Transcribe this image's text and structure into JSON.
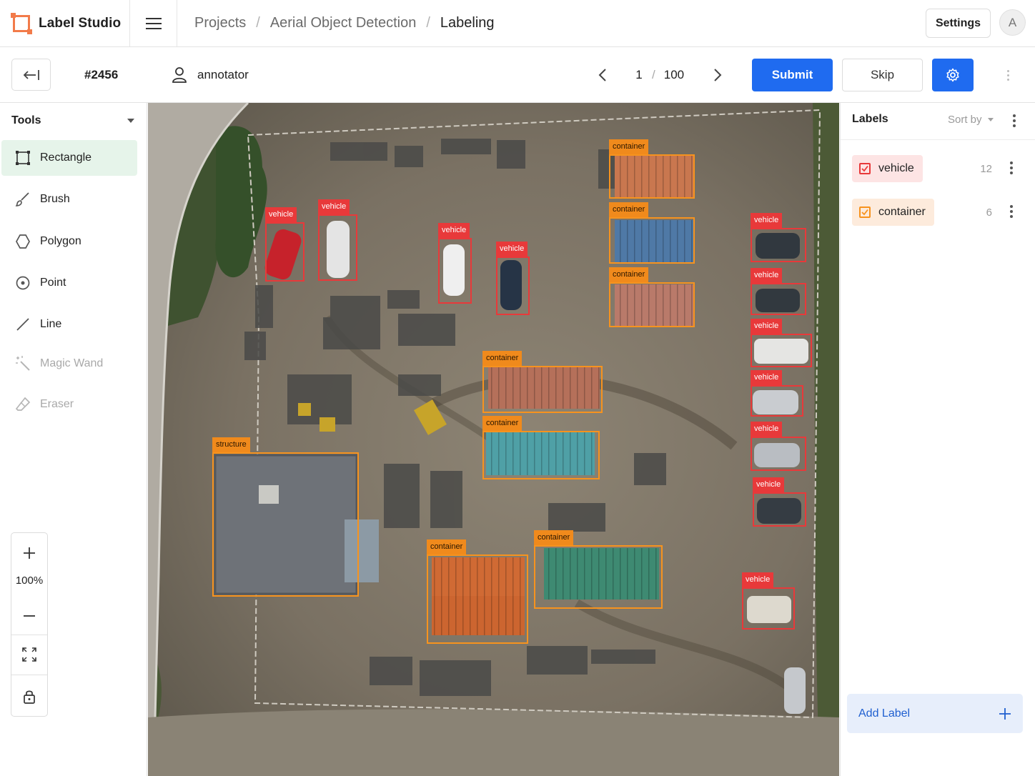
{
  "app": {
    "name": "Label Studio"
  },
  "header": {
    "breadcrumb": [
      "Projects",
      "Aerial Object Detection",
      "Labeling"
    ],
    "settings_label": "Settings",
    "avatar_initial": "A"
  },
  "task": {
    "id": "#2456",
    "annotator": "annotator",
    "page_current": "1",
    "page_separator": "/",
    "page_total": "100",
    "submit_label": "Submit",
    "skip_label": "Skip"
  },
  "tools": {
    "title": "Tools",
    "items": [
      {
        "label": "Rectangle",
        "icon": "rectangle-icon",
        "state": "active"
      },
      {
        "label": "Brush",
        "icon": "brush-icon",
        "state": "enabled"
      },
      {
        "label": "Polygon",
        "icon": "polygon-icon",
        "state": "enabled"
      },
      {
        "label": "Point",
        "icon": "point-icon",
        "state": "enabled"
      },
      {
        "label": "Line",
        "icon": "line-icon",
        "state": "enabled"
      },
      {
        "label": "Magic Wand",
        "icon": "magic-wand-icon",
        "state": "disabled"
      },
      {
        "label": "Eraser",
        "icon": "eraser-icon",
        "state": "disabled"
      }
    ],
    "zoom_level": "100%"
  },
  "canvas": {
    "annotations": [
      {
        "label": "vehicle"
      },
      {
        "label": "vehicle"
      },
      {
        "label": "vehicle"
      },
      {
        "label": "vehicle"
      },
      {
        "label": "container"
      },
      {
        "label": "container"
      },
      {
        "label": "container"
      },
      {
        "label": "vehicle"
      },
      {
        "label": "vehicle"
      },
      {
        "label": "vehicle"
      },
      {
        "label": "vehicle"
      },
      {
        "label": "vehicle"
      },
      {
        "label": "vehicle"
      },
      {
        "label": "container"
      },
      {
        "label": "container"
      },
      {
        "label": "structure"
      },
      {
        "label": "container"
      },
      {
        "label": "container"
      },
      {
        "label": "vehicle"
      }
    ]
  },
  "labels_panel": {
    "title": "Labels",
    "sort_label": "Sort by",
    "items": [
      {
        "name": "vehicle",
        "count": "12",
        "color": "#e8393a",
        "background": "#fde4e4"
      },
      {
        "name": "container",
        "count": "6",
        "color": "#f7931e",
        "background": "#fdebdc"
      }
    ],
    "add_label": "Add Label"
  },
  "colors": {
    "accent": "#1f6bf0",
    "active_tool_bg": "#e6f4ea",
    "brand": "#f27b4a"
  }
}
